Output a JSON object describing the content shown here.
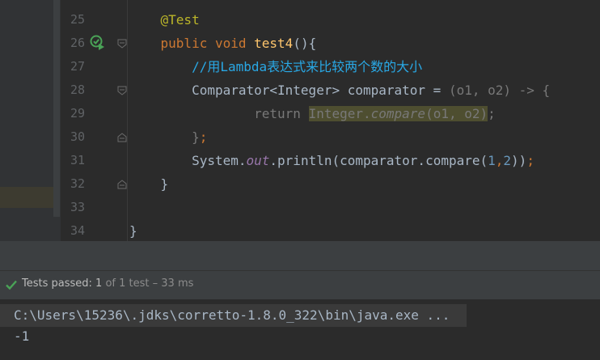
{
  "editor": {
    "line_numbers": [
      "25",
      "26",
      "27",
      "28",
      "29",
      "30",
      "31",
      "32",
      "33",
      "34"
    ],
    "lines": {
      "l25": {
        "annotation": "@Test"
      },
      "l26": {
        "kw_public": "public",
        "kw_void": "void",
        "method_name": "test4",
        "rest": "(){"
      },
      "l27": {
        "comment": "//用Lambda表达式来比较两个数的大小"
      },
      "l28": {
        "text": "Comparator<Integer> comparator = ",
        "params": "(o1, o2) -> {"
      },
      "l29": {
        "kw_return": "return",
        "class_name": "Integer.",
        "method": "compare",
        "args": "(o1, o2)",
        "semi": ";"
      },
      "l30": {
        "brace": "}",
        "semi": ";"
      },
      "l31": {
        "prefix": "System.",
        "field": "out",
        "call": ".println(comparator.compare(",
        "n1": "1",
        "comma": ",",
        "n2": "2",
        "close": "))",
        "semi": ";"
      },
      "l32": {
        "brace": "}"
      },
      "l34": {
        "brace": "}"
      }
    }
  },
  "status": {
    "tests_passed_label": "Tests passed:",
    "passed_count": "1",
    "of_text": "of 1 test – 33 ms"
  },
  "console": {
    "command": "C:\\Users\\15236\\.jdks\\corretto-1.8.0_322\\bin\\java.exe ...",
    "output": "-1"
  },
  "colors": {
    "background": "#2b2b2b",
    "keyword": "#cc7832",
    "annotation": "#bbb529",
    "method": "#ffc66d",
    "comment": "#29a8e5",
    "number": "#6897bb",
    "success": "#4aa357"
  }
}
